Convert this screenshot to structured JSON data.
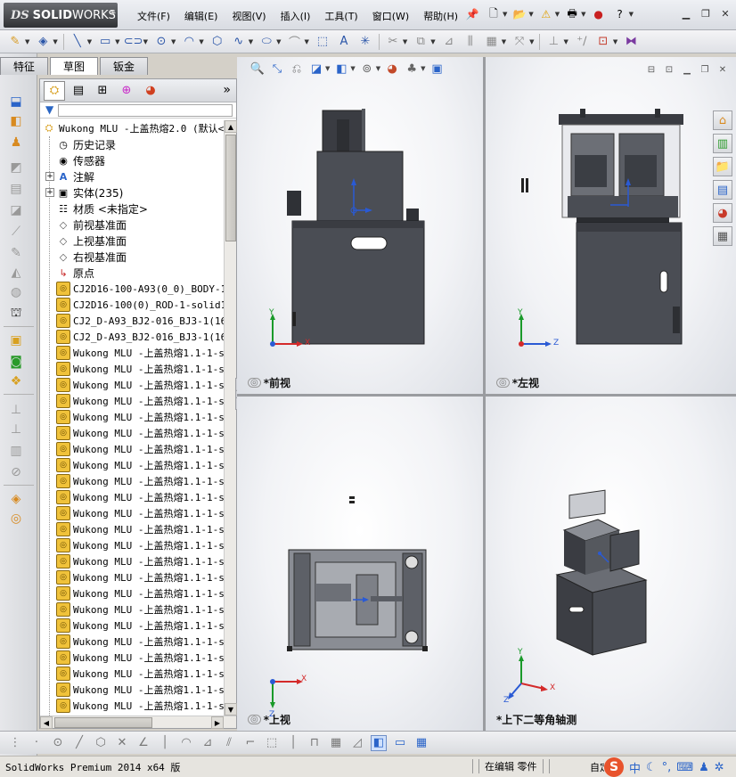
{
  "app": {
    "brand_ds": "DS",
    "brand_solid": "SOLID",
    "brand_works": "WORKS"
  },
  "menu": [
    "文件(F)",
    "编辑(E)",
    "视图(V)",
    "插入(I)",
    "工具(T)",
    "窗口(W)",
    "帮助(H)"
  ],
  "tabs": [
    {
      "label": "特征",
      "active": false
    },
    {
      "label": "草图",
      "active": true
    },
    {
      "label": "钣金",
      "active": false
    }
  ],
  "tree": {
    "root": "Wukong MLU -上盖热熔2.0  (默认<",
    "items": [
      {
        "label": "历史记录",
        "icon": "history-icon",
        "expandable": false
      },
      {
        "label": "传感器",
        "icon": "sensor-icon",
        "expandable": false
      },
      {
        "label": "注解",
        "icon": "annotation-icon",
        "expandable": true
      },
      {
        "label": "实体(235)",
        "icon": "solid-bodies-icon",
        "expandable": true
      },
      {
        "label": "材质 <未指定>",
        "icon": "material-icon",
        "expandable": false
      },
      {
        "label": "前视基准面",
        "icon": "plane-icon",
        "expandable": false
      },
      {
        "label": "上视基准面",
        "icon": "plane-icon",
        "expandable": false
      },
      {
        "label": "右视基准面",
        "icon": "plane-icon",
        "expandable": false
      },
      {
        "label": "原点",
        "icon": "origin-icon",
        "expandable": false
      },
      {
        "label": "CJ2D16-100-A93(0_0)_BODY-1-s",
        "icon": "part-icon",
        "expandable": false
      },
      {
        "label": "CJ2D16-100(0)_ROD-1-solid1",
        "icon": "part-icon",
        "expandable": false
      },
      {
        "label": "CJ2_D-A93_BJ2-016_BJ3-1(16_",
        "icon": "part-icon",
        "expandable": false
      },
      {
        "label": "CJ2_D-A93_BJ2-016_BJ3-1(16_",
        "icon": "part-icon",
        "expandable": false
      },
      {
        "label": "Wukong MLU -上盖热熔1.1-1-s",
        "icon": "part-icon",
        "expandable": false
      },
      {
        "label": "Wukong MLU -上盖热熔1.1-1-s",
        "icon": "part-icon",
        "expandable": false
      },
      {
        "label": "Wukong MLU -上盖热熔1.1-1-s",
        "icon": "part-icon",
        "expandable": false
      },
      {
        "label": "Wukong MLU -上盖热熔1.1-1-s",
        "icon": "part-icon",
        "expandable": false
      },
      {
        "label": "Wukong MLU -上盖热熔1.1-1-s",
        "icon": "part-icon",
        "expandable": false
      },
      {
        "label": "Wukong MLU -上盖热熔1.1-1-s",
        "icon": "part-icon",
        "expandable": false
      },
      {
        "label": "Wukong MLU -上盖热熔1.1-1-s",
        "icon": "part-icon",
        "expandable": false
      },
      {
        "label": "Wukong MLU -上盖热熔1.1-1-s",
        "icon": "part-icon",
        "expandable": false
      },
      {
        "label": "Wukong MLU -上盖热熔1.1-1-s",
        "icon": "part-icon",
        "expandable": false
      },
      {
        "label": "Wukong MLU -上盖热熔1.1-1-s",
        "icon": "part-icon",
        "expandable": false
      },
      {
        "label": "Wukong MLU -上盖热熔1.1-1-s",
        "icon": "part-icon",
        "expandable": false
      },
      {
        "label": "Wukong MLU -上盖热熔1.1-1-s",
        "icon": "part-icon",
        "expandable": false
      },
      {
        "label": "Wukong MLU -上盖热熔1.1-1-s",
        "icon": "part-icon",
        "expandable": false
      },
      {
        "label": "Wukong MLU -上盖热熔1.1-1-s",
        "icon": "part-icon",
        "expandable": false
      },
      {
        "label": "Wukong MLU -上盖热熔1.1-1-s",
        "icon": "part-icon",
        "expandable": false
      },
      {
        "label": "Wukong MLU -上盖热熔1.1-1-s",
        "icon": "part-icon",
        "expandable": false
      },
      {
        "label": "Wukong MLU -上盖热熔1.1-1-s",
        "icon": "part-icon",
        "expandable": false
      },
      {
        "label": "Wukong MLU -上盖热熔1.1-1-s",
        "icon": "part-icon",
        "expandable": false
      },
      {
        "label": "Wukong MLU -上盖热熔1.1-1-s",
        "icon": "part-icon",
        "expandable": false
      },
      {
        "label": "Wukong MLU -上盖热熔1.1-1-s",
        "icon": "part-icon",
        "expandable": false
      },
      {
        "label": "Wukong MLU -上盖热熔1.1-1-s",
        "icon": "part-icon",
        "expandable": false
      },
      {
        "label": "Wukong MLU -上盖热熔1.1-1-s",
        "icon": "part-icon",
        "expandable": false
      },
      {
        "label": "Wukong MLU -上盖热熔1.1-1-s",
        "icon": "part-icon",
        "expandable": false
      }
    ]
  },
  "viewports": {
    "front": "*前视",
    "left": "*左视",
    "top": "*上视",
    "iso": "*上下二等角轴测"
  },
  "axes": {
    "x": "X",
    "y": "Y",
    "z": "Z"
  },
  "status": {
    "product": "SolidWorks Premium 2014 x64 版",
    "editing": "在编辑 零件",
    "auto": "自定",
    "ime_mode": "中"
  },
  "colors": {
    "axis_x": "#d42a2a",
    "axis_y": "#1a9a2a",
    "axis_z": "#2a5ad4",
    "model_dark": "#3c3e44",
    "model_light": "#7a7d84"
  }
}
